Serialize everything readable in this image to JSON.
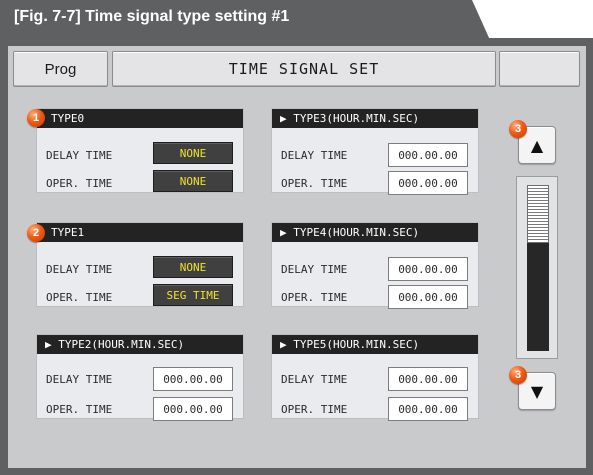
{
  "figure": {
    "caption": "[Fig. 7-7] Time signal type setting #1"
  },
  "header": {
    "prog_label": "Prog",
    "title": "TIME SIGNAL SET",
    "blank_label": ""
  },
  "groups": [
    {
      "title": "TYPE0",
      "delay_label": "DELAY TIME",
      "oper_label": "OPER. TIME",
      "delay_value": "NONE",
      "oper_value": "NONE"
    },
    {
      "title": "TYPE1",
      "delay_label": "DELAY TIME",
      "oper_label": "OPER. TIME",
      "delay_value": "NONE",
      "oper_value": "SEG TIME"
    },
    {
      "title": "▶ TYPE2(HOUR.MIN.SEC)",
      "delay_label": "DELAY TIME",
      "oper_label": "OPER. TIME",
      "delay_value": "000.00.00",
      "oper_value": "000.00.00"
    },
    {
      "title": "▶ TYPE3(HOUR.MIN.SEC)",
      "delay_label": "DELAY TIME",
      "oper_label": "OPER. TIME",
      "delay_value": "000.00.00",
      "oper_value": "000.00.00"
    },
    {
      "title": "▶ TYPE4(HOUR.MIN.SEC)",
      "delay_label": "DELAY TIME",
      "oper_label": "OPER. TIME",
      "delay_value": "000.00.00",
      "oper_value": "000.00.00"
    },
    {
      "title": "▶ TYPE5(HOUR.MIN.SEC)",
      "delay_label": "DELAY TIME",
      "oper_label": "OPER. TIME",
      "delay_value": "000.00.00",
      "oper_value": "000.00.00"
    }
  ],
  "badges": {
    "one": "1",
    "two": "2",
    "three": "3"
  },
  "scroll": {
    "up_icon": "up-arrow-icon",
    "down_icon": "down-arrow-icon",
    "up_glyph": "▲",
    "down_glyph": "▼",
    "position": 0
  },
  "colors": {
    "frame": "#5f6062",
    "screen": "#c9cacc",
    "dark_value_text": "#f1e32a",
    "badge": "#f05a14"
  }
}
